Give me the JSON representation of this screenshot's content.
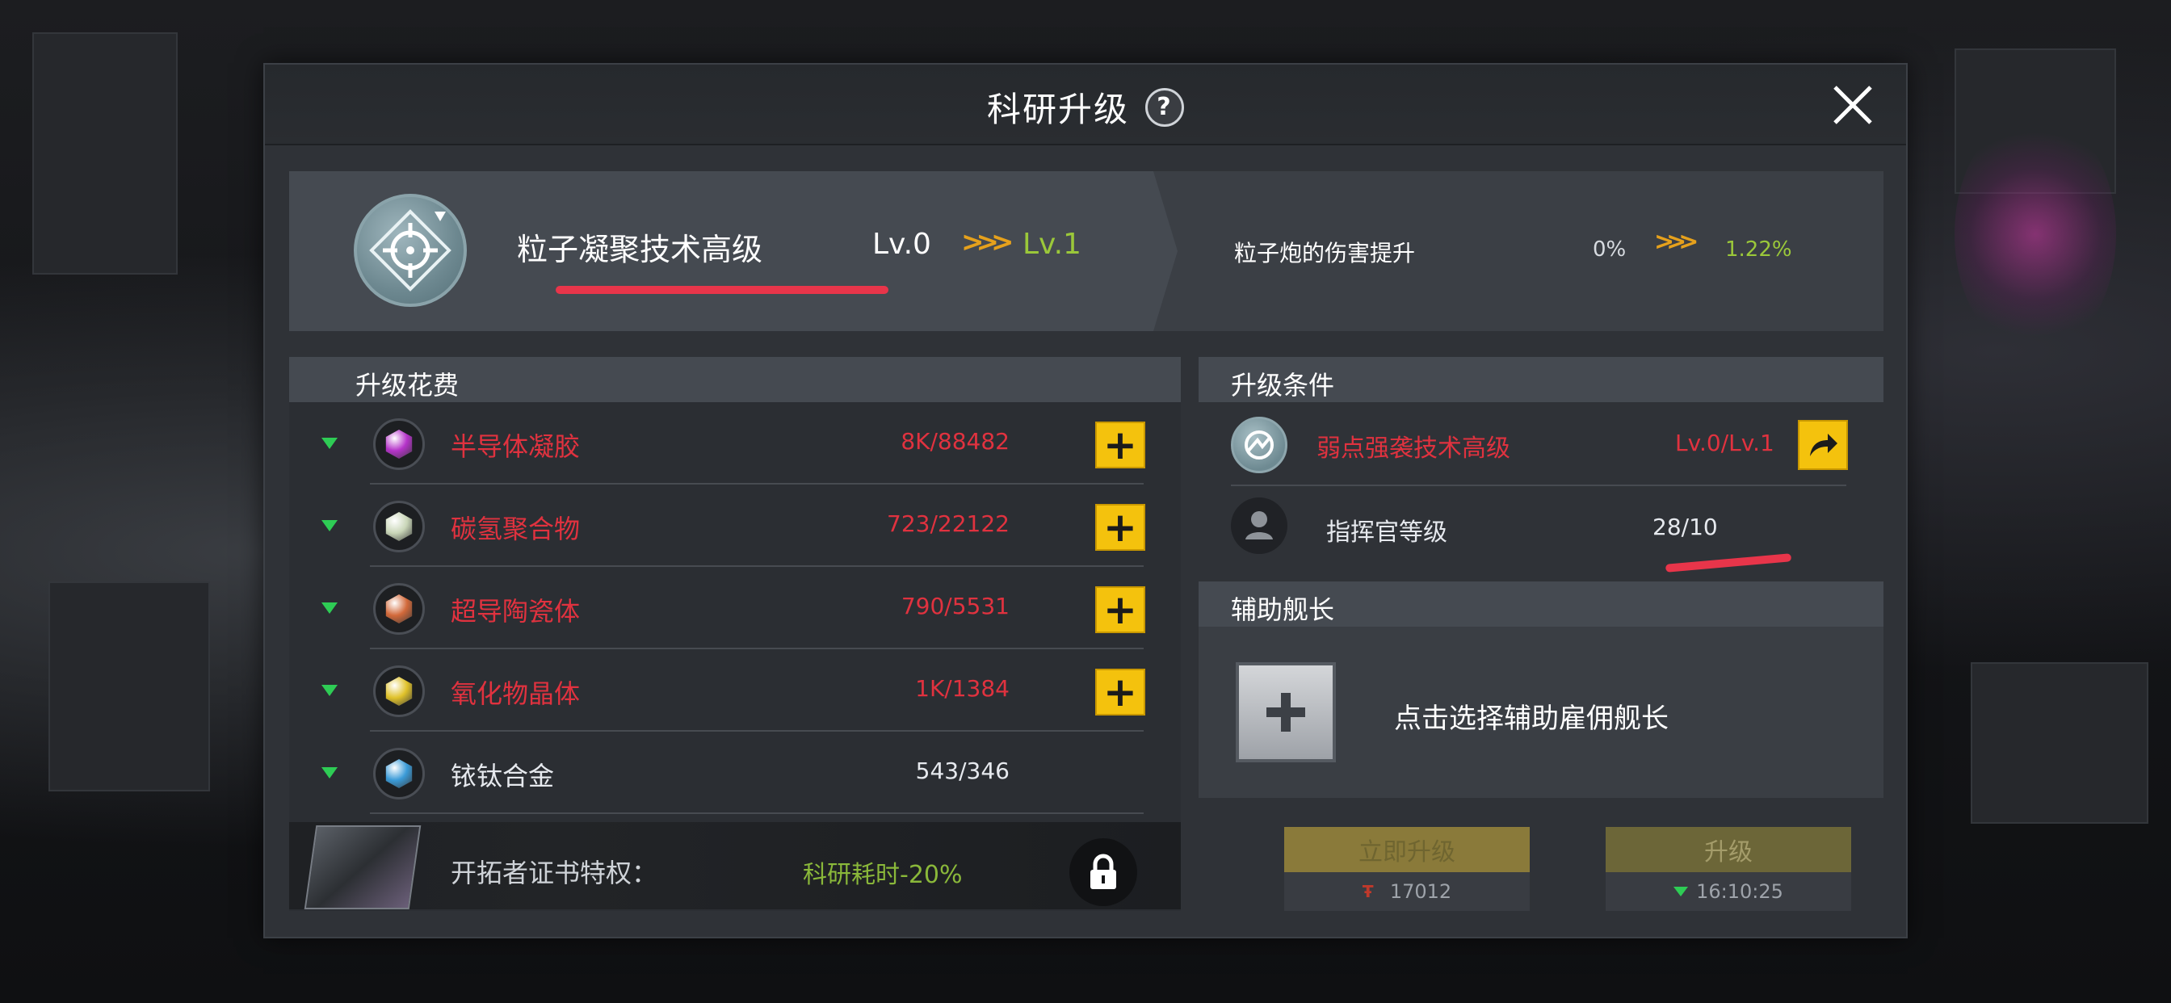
{
  "header": {
    "title": "科研升级",
    "help_icon": "?"
  },
  "tech": {
    "name": "粒子凝聚技术高级",
    "level_from": "Lv.0",
    "level_to": "Lv.1",
    "arrows": ">>>",
    "effect_label": "粒子炮的伤害提升",
    "effect_from": "0%",
    "effect_to": "1.22%"
  },
  "cost": {
    "title": "升级花费",
    "items": [
      {
        "name": "半导体凝胶",
        "amount": "8K/88482",
        "insufficient": true,
        "gem_color": "#b533c9",
        "icon": "semiconductor-gel-icon"
      },
      {
        "name": "碳氢聚合物",
        "amount": "723/22122",
        "insufficient": true,
        "gem_color": "#c9d6b8",
        "icon": "hydrocarbon-polymer-icon"
      },
      {
        "name": "超导陶瓷体",
        "amount": "790/5531",
        "insufficient": true,
        "gem_color": "#d2693a",
        "icon": "superconductor-ceramic-icon"
      },
      {
        "name": "氧化物晶体",
        "amount": "1K/1384",
        "insufficient": true,
        "gem_color": "#e0c22a",
        "icon": "oxide-crystal-icon"
      },
      {
        "name": "铱钛合金",
        "amount": "543/346",
        "insufficient": false,
        "gem_color": "#3a9bd8",
        "icon": "iridium-titanium-alloy-icon"
      }
    ],
    "add_label": "+"
  },
  "privilege": {
    "label": "开拓者证书特权：",
    "value": "科研耗时-20%"
  },
  "conditions": {
    "title": "升级条件",
    "items": [
      {
        "name": "弱点强袭技术高级",
        "value": "Lv.0/Lv.1",
        "met": false
      },
      {
        "name": "指挥官等级",
        "value": "28/10",
        "met": true
      }
    ]
  },
  "assist": {
    "title": "辅助舰长",
    "hint": "点击选择辅助雇佣舰长"
  },
  "actions": {
    "instant": {
      "label": "立即升级",
      "cost": "17012"
    },
    "upgrade": {
      "label": "升级",
      "time": "16:10:25"
    }
  },
  "colors": {
    "accent_yellow": "#f4c20d",
    "insufficient_red": "#e0323f",
    "positive_green": "#9bc83a",
    "annotation_red": "#e8354a"
  }
}
